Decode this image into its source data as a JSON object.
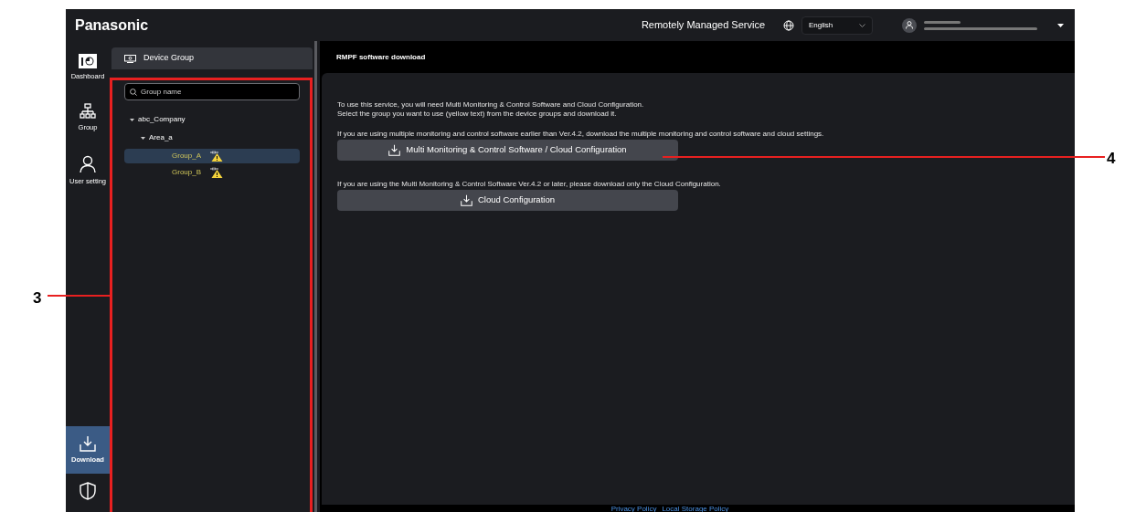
{
  "header": {
    "logo": "Panasonic",
    "service": "Remotely Managed Service",
    "language": "English"
  },
  "nav": [
    {
      "label": "Dashboard",
      "kind": "dashboard",
      "selected": false
    },
    {
      "label": "Group",
      "kind": "group",
      "selected": false
    },
    {
      "label": "User setting",
      "kind": "user",
      "selected": false
    },
    {
      "label": "Download",
      "kind": "download",
      "selected": true
    },
    {
      "kind": "shield",
      "selected": false
    }
  ],
  "device_group": {
    "title": "Device Group",
    "search": {
      "placeholder": "Group name"
    },
    "tree": [
      {
        "label": "abc_Company",
        "expanded": true,
        "children": [
          {
            "label": "Area_a",
            "expanded": true,
            "children": [
              {
                "label": "Group_A",
                "selected": true,
                "warning": true
              },
              {
                "label": "Group_B",
                "selected": false,
                "warning": true
              }
            ]
          }
        ]
      }
    ]
  },
  "main": {
    "title": "RMPF software download",
    "intro": [
      "To use this service, you will need Multi Monitoring & Control Software and Cloud Configuration.",
      "Select the group you want to use (yellow text) from the device groups and download it."
    ],
    "sections": [
      {
        "text": "If you are using multiple monitoring and control software earlier than Ver.4.2, download the multiple monitoring and control software and cloud settings.",
        "button": "Multi Monitoring & Control Software / Cloud Configuration"
      },
      {
        "text": "If you are using the Multi Monitoring & Control Software Ver.4.2 or later, please download only the Cloud Configuration.",
        "button": "Cloud Configuration"
      }
    ]
  },
  "footer": {
    "links": [
      "Privacy Policy",
      "Local Storage Policy"
    ]
  },
  "callouts": [
    {
      "label": "3"
    },
    {
      "label": "4"
    }
  ]
}
